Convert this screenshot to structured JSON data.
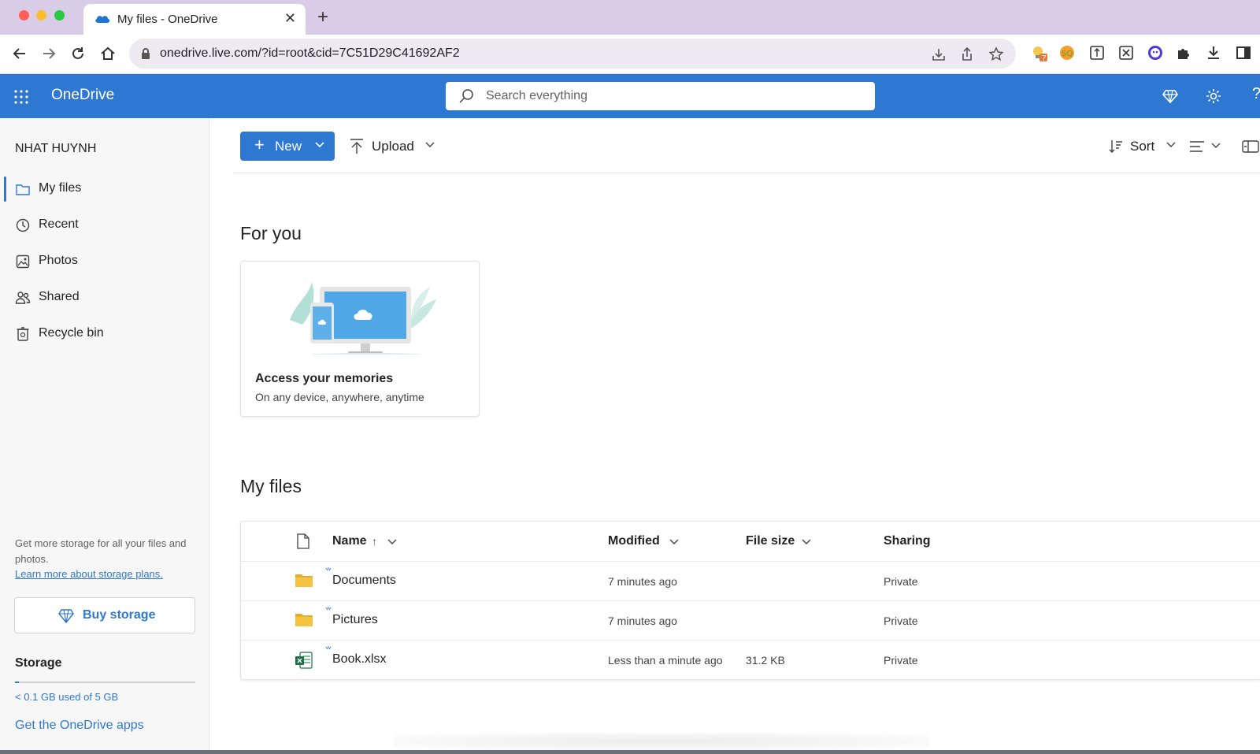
{
  "browser": {
    "tab_title": "My files - OneDrive",
    "url": "onedrive.live.com/?id=root&cid=7C51D29C41692AF2",
    "extension_badge": "7"
  },
  "header": {
    "brand": "OneDrive",
    "search_placeholder": "Search everything"
  },
  "sidebar": {
    "user_name": "NHAT HUYNH",
    "items": [
      {
        "label": "My files",
        "icon": "folder-icon",
        "active": true
      },
      {
        "label": "Recent",
        "icon": "clock-icon",
        "active": false
      },
      {
        "label": "Photos",
        "icon": "photo-icon",
        "active": false
      },
      {
        "label": "Shared",
        "icon": "people-icon",
        "active": false
      },
      {
        "label": "Recycle bin",
        "icon": "recycle-bin-icon",
        "active": false
      }
    ],
    "promo_text": "Get more storage for all your files and photos.",
    "promo_link": "Learn more about storage plans.",
    "buy_storage": "Buy storage",
    "storage_title": "Storage",
    "storage_used": "< 0.1 GB used of 5 GB",
    "storage_fraction": 0.02,
    "get_apps": "Get the OneDrive apps"
  },
  "command_bar": {
    "new_label": "New",
    "upload_label": "Upload",
    "sort_label": "Sort"
  },
  "for_you": {
    "title": "For you",
    "card_title": "Access your memories",
    "card_subtitle": "On any device, anywhere, anytime"
  },
  "my_files": {
    "title": "My files",
    "columns": {
      "name": "Name",
      "name_sort": "↑",
      "modified": "Modified",
      "size": "File size",
      "sharing": "Sharing"
    },
    "rows": [
      {
        "name": "Documents",
        "type": "folder",
        "modified": "7 minutes ago",
        "size": "",
        "sharing": "Private"
      },
      {
        "name": "Pictures",
        "type": "folder",
        "modified": "7 minutes ago",
        "size": "",
        "sharing": "Private"
      },
      {
        "name": "Book.xlsx",
        "type": "excel",
        "modified": "Less than a minute ago",
        "size": "31.2 KB",
        "sharing": "Private"
      }
    ]
  },
  "colors": {
    "brand_blue": "#2f78d1",
    "folder_yellow": "#f5c342",
    "excel_green": "#1e7145"
  }
}
